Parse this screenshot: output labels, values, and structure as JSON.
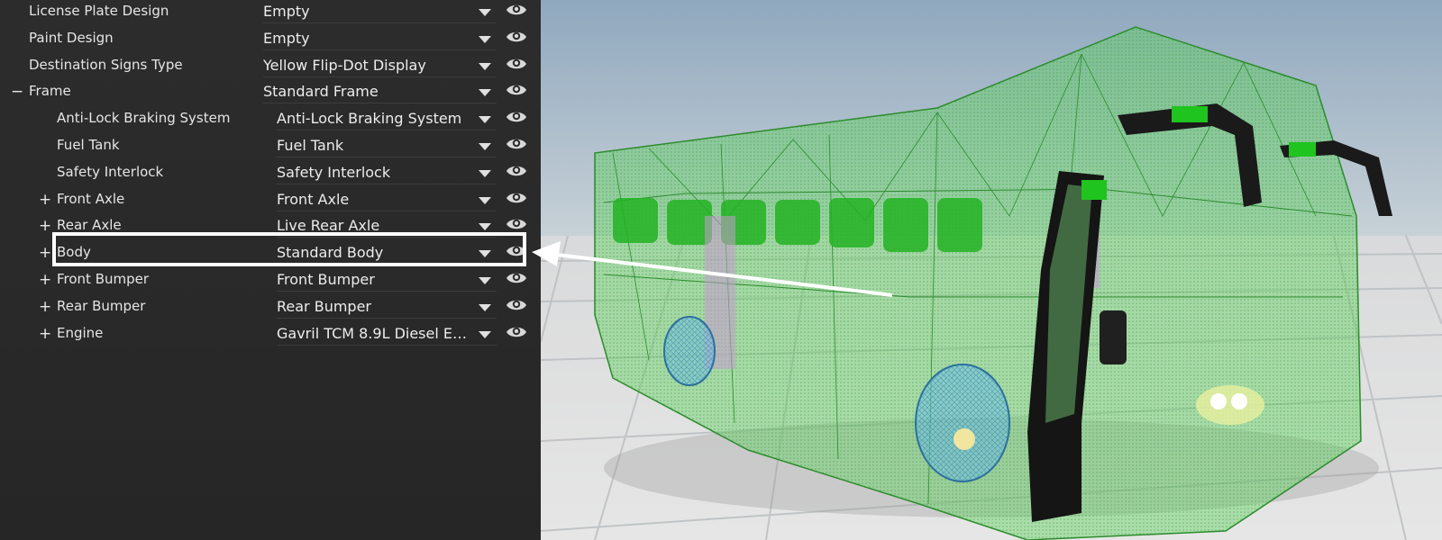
{
  "panel": {
    "rows": [
      {
        "label": "License Plate Design",
        "value": "Empty",
        "expander": ""
      },
      {
        "label": "Paint Design",
        "value": "Empty",
        "expander": ""
      },
      {
        "label": "Destination Signs Type",
        "value": "Yellow Flip-Dot Display",
        "expander": ""
      },
      {
        "label": "Frame",
        "value": "Standard Frame",
        "expander": "−"
      },
      {
        "label": "Anti-Lock Braking System",
        "value": "Anti-Lock Braking System",
        "expander": ""
      },
      {
        "label": "Fuel Tank",
        "value": "Fuel Tank",
        "expander": ""
      },
      {
        "label": "Safety Interlock",
        "value": "Safety Interlock",
        "expander": ""
      },
      {
        "label": "Front Axle",
        "value": "Front Axle",
        "expander": "+"
      },
      {
        "label": "Rear Axle",
        "value": "Live Rear Axle",
        "expander": "+"
      },
      {
        "label": "Body",
        "value": "Standard Body",
        "expander": "+"
      },
      {
        "label": "Front Bumper",
        "value": "Front Bumper",
        "expander": "+"
      },
      {
        "label": "Rear Bumper",
        "value": "Rear Bumper",
        "expander": "+"
      },
      {
        "label": "Engine",
        "value": "Gavril TCM 8.9L Diesel Eng...",
        "expander": "+"
      }
    ],
    "highlighted_row": "Body"
  },
  "colors": {
    "panel_bg": "#2b2b2b",
    "text": "#e6e6e6",
    "highlight": "#ffffff",
    "sky": "#9fb6c9",
    "floor": "#dfdfdf",
    "wireframe_green": "#3fbf3f"
  },
  "icons": {
    "visibility": "eye-icon",
    "dropdown": "caret-down-icon",
    "expand": "plus-icon",
    "collapse": "minus-icon"
  }
}
